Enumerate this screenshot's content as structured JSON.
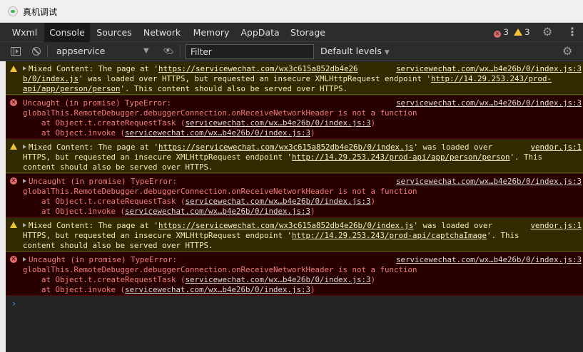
{
  "window": {
    "title": "真机调试"
  },
  "tabs": [
    {
      "label": "Wxml"
    },
    {
      "label": "Console"
    },
    {
      "label": "Sources"
    },
    {
      "label": "Network"
    },
    {
      "label": "Memory"
    },
    {
      "label": "AppData"
    },
    {
      "label": "Storage"
    }
  ],
  "counts": {
    "errors": "3",
    "warnings": "3"
  },
  "toolbar": {
    "context": "appservice",
    "filter_placeholder": "Filter",
    "levels": "Default levels"
  },
  "messages": [
    {
      "level": "warning",
      "lines": [
        [
          "Mixed Content: The page at '",
          "https://servicewechat.com/wx3c615a852db4e26",
          ""
        ],
        [
          "",
          "b/0/index.js",
          "' was loaded over HTTPS, but requested an insecure XMLHttpRequest endpoint '",
          "http://14.29.253.243/prod-"
        ],
        [
          "",
          "api/app/person/person",
          "'. This content should also be served over HTTPS."
        ]
      ],
      "source": "servicewechat.com/wx…b4e26b/0/index.js:3"
    },
    {
      "level": "error",
      "lines": [
        [
          "Uncaught (in promise) TypeError:"
        ],
        [
          "globalThis.RemoteDebugger.debuggerConnection.onReceiveNetworkHeader is not a function"
        ],
        [
          "    at Object.t.createRequestTask (",
          "servicewechat.com/wx…b4e26b/0/index.js:3",
          ")"
        ],
        [
          "    at Object.invoke (",
          "servicewechat.com/wx…b4e26b/0/index.js:3",
          ")"
        ]
      ],
      "source": "servicewechat.com/wx…b4e26b/0/index.js:3"
    },
    {
      "level": "warning",
      "lines": [
        [
          "Mixed Content: The page at '",
          "https://servicewechat.com/wx3c615a852db4e26b/0/index.js",
          "' was loaded over "
        ],
        [
          "HTTPS, but requested an insecure XMLHttpRequest endpoint '",
          "http://14.29.253.243/prod-api/app/person/person",
          "'. This"
        ],
        [
          "content should also be served over HTTPS."
        ]
      ],
      "source": "vendor.js:1"
    },
    {
      "level": "error",
      "lines": [
        [
          "Uncaught (in promise) TypeError:"
        ],
        [
          "globalThis.RemoteDebugger.debuggerConnection.onReceiveNetworkHeader is not a function"
        ],
        [
          "    at Object.t.createRequestTask (",
          "servicewechat.com/wx…b4e26b/0/index.js:3",
          ")"
        ],
        [
          "    at Object.invoke (",
          "servicewechat.com/wx…b4e26b/0/index.js:3",
          ")"
        ]
      ],
      "source": "servicewechat.com/wx…b4e26b/0/index.js:3"
    },
    {
      "level": "warning",
      "lines": [
        [
          "Mixed Content: The page at '",
          "https://servicewechat.com/wx3c615a852db4e26b/0/index.js",
          "' was loaded over "
        ],
        [
          "HTTPS, but requested an insecure XMLHttpRequest endpoint '",
          "http://14.29.253.243/prod-api/captchaImage",
          "'. This"
        ],
        [
          "content should also be served over HTTPS."
        ]
      ],
      "source": "vendor.js:1"
    },
    {
      "level": "error",
      "lines": [
        [
          "Uncaught (in promise) TypeError:"
        ],
        [
          "globalThis.RemoteDebugger.debuggerConnection.onReceiveNetworkHeader is not a function"
        ],
        [
          "    at Object.t.createRequestTask (",
          "servicewechat.com/wx…b4e26b/0/index.js:3",
          ")"
        ],
        [
          "    at Object.invoke (",
          "servicewechat.com/wx…b4e26b/0/index.js:3",
          ")"
        ]
      ],
      "source": "servicewechat.com/wx…b4e26b/0/index.js:3"
    }
  ],
  "console": {
    "prompt": "›"
  },
  "icons": {
    "title": "wechat-devtools-icon",
    "settings": "gear-icon",
    "more": "kebab-icon",
    "sidebar": "sidebar-toggle-icon",
    "clear": "clear-console-icon",
    "live": "eye-icon",
    "console_settings": "gear-icon"
  },
  "colors": {
    "warning_bg": "#332b00",
    "error_bg": "#290000",
    "error_icon": "#e06c6c",
    "warning_icon": "#f0c237",
    "prompt": "#4f8fe6"
  }
}
